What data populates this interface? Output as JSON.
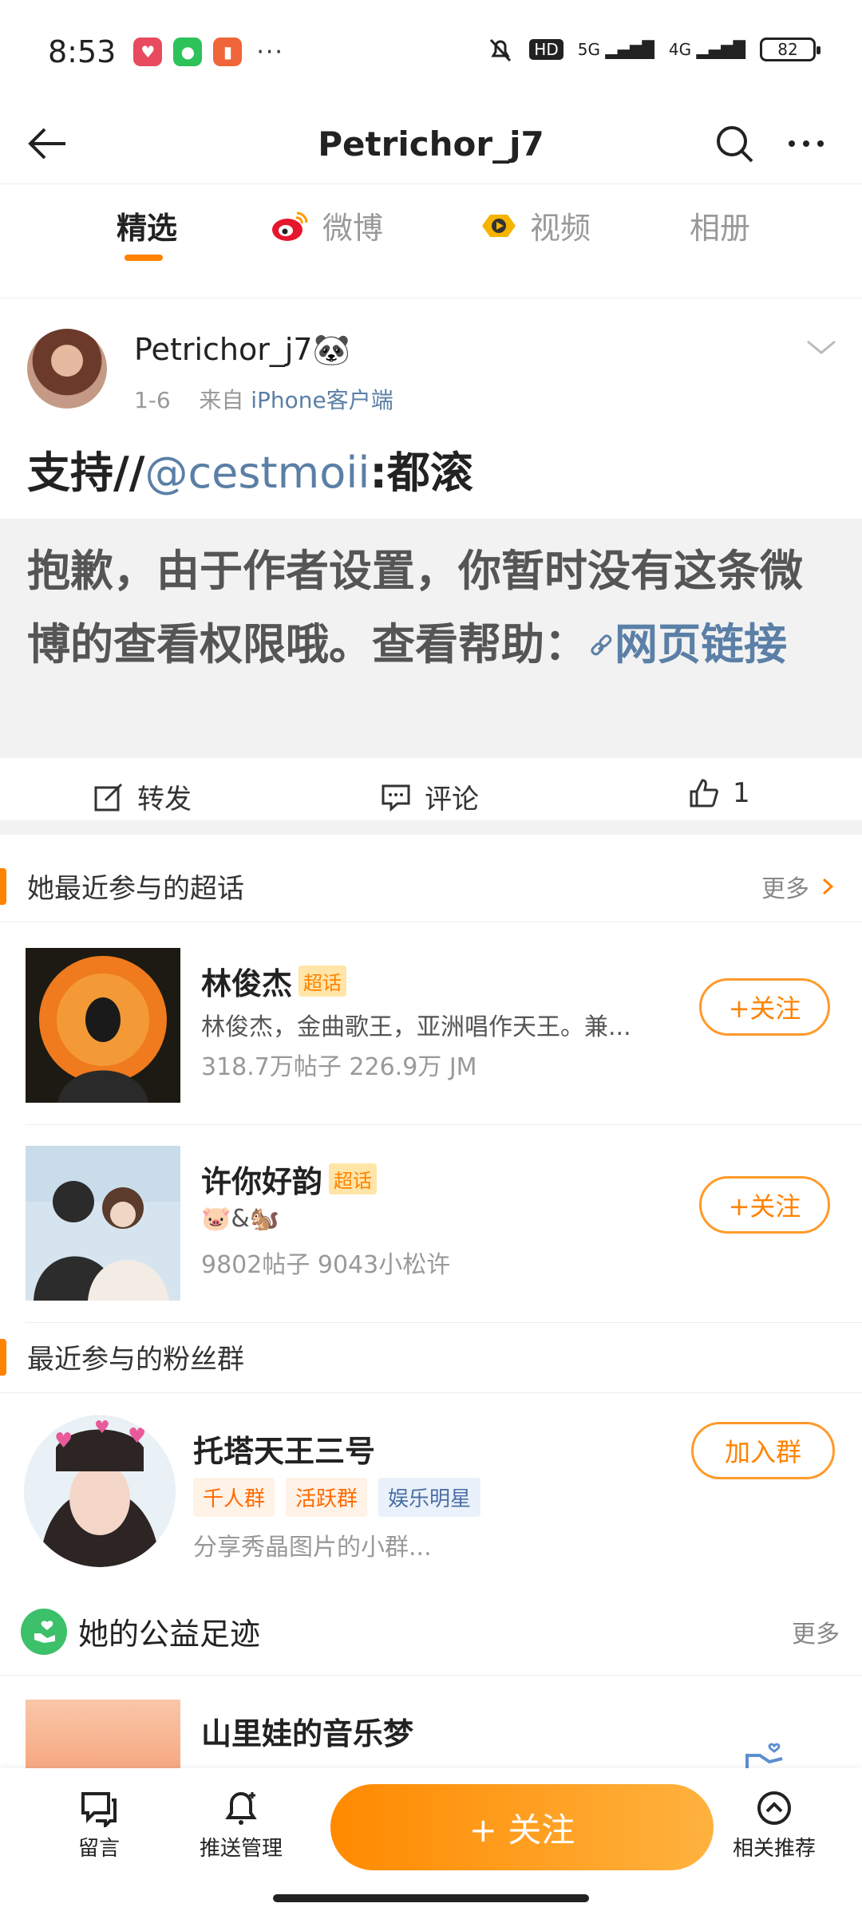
{
  "status_bar": {
    "time": "8:53",
    "hd": "HD",
    "net1": "5G",
    "net2": "4G",
    "battery": "82",
    "more": "···"
  },
  "nav": {
    "title": "Petrichor_j7"
  },
  "tabs": [
    {
      "label": "精选",
      "active": true
    },
    {
      "label": "微博",
      "active": false
    },
    {
      "label": "视频",
      "active": false
    },
    {
      "label": "相册",
      "active": false
    }
  ],
  "post": {
    "author": "Petrichor_j7",
    "author_emoji": "🐼",
    "date": "1-6",
    "from_label": "来自",
    "device": "iPhone客户端",
    "text_prefix": "支持//",
    "mention": "@cestmoii",
    "text_suffix": ":都滚",
    "quote_text": "抱歉，由于作者设置，你暂时没有这条微博的查看权限哦。查看帮助：",
    "quote_link": "网页链接"
  },
  "actions": {
    "repost": "转发",
    "comment": "评论",
    "like_count": "1"
  },
  "super_topics": {
    "title": "她最近参与的超话",
    "more": "更多",
    "tag": "超话",
    "items": [
      {
        "name": "林俊杰",
        "desc": "林俊杰，金曲歌王，亚洲唱作天王。兼...",
        "stats": "318.7万帖子 226.9万 JM",
        "button": "+关注"
      },
      {
        "name": "许你好韵",
        "desc": "🐷&🐿️",
        "stats": "9802帖子 9043小松许",
        "button": "+关注"
      }
    ]
  },
  "fan_groups": {
    "title": "最近参与的粉丝群",
    "items": [
      {
        "name": "托塔天王三号",
        "tags": [
          "千人群",
          "活跃群",
          "娱乐明星"
        ],
        "desc": "分享秀晶图片的小群...",
        "button": "加入群"
      }
    ]
  },
  "charity": {
    "title": "她的公益足迹",
    "more": "更多",
    "item_name": "山里娃的音乐梦"
  },
  "bottom_bar": {
    "message": "留言",
    "push": "推送管理",
    "follow": "+ 关注",
    "related": "相关推荐"
  },
  "colors": {
    "accent": "#ff8200",
    "link": "#5b7fa6",
    "charity_green": "#3cc06a"
  }
}
